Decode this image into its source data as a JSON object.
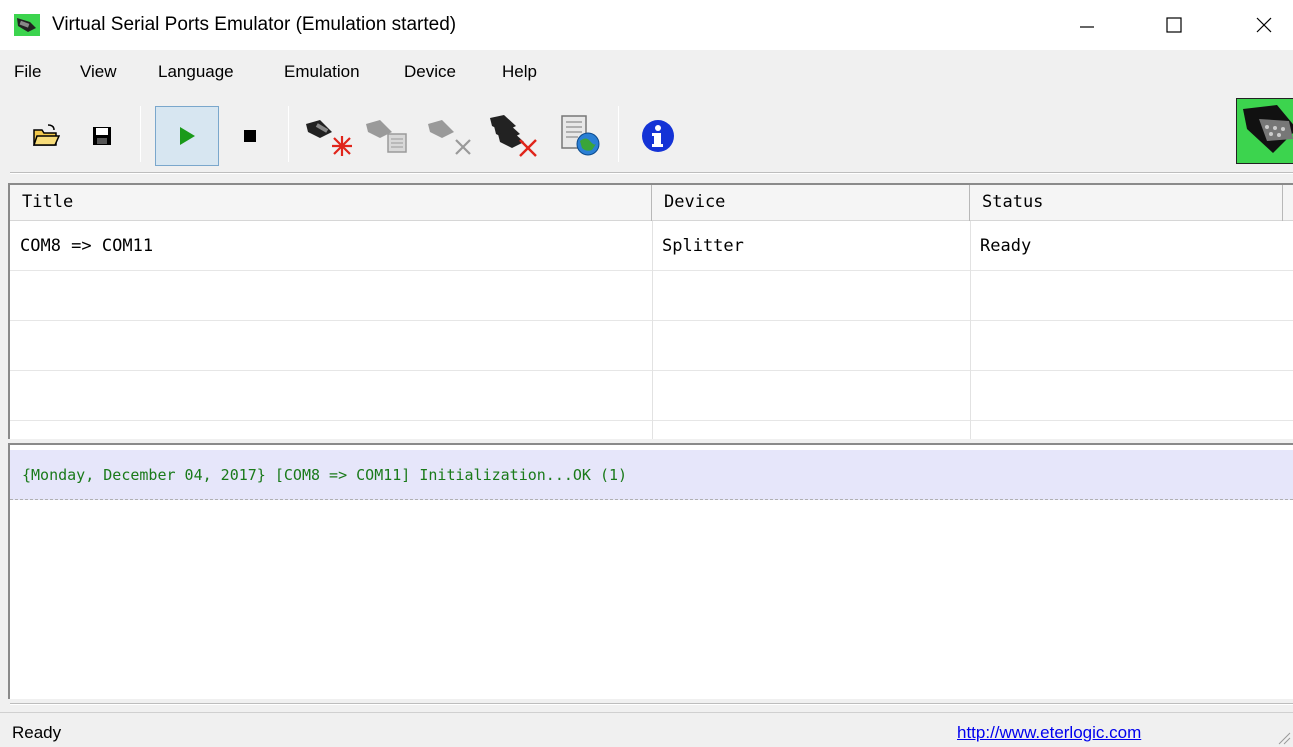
{
  "window": {
    "title": "Virtual Serial Ports Emulator (Emulation started)",
    "minimize": "—",
    "maximize": "☐",
    "close": "✕"
  },
  "menu": [
    "File",
    "View",
    "Language",
    "Emulation",
    "Device",
    "Help"
  ],
  "toolbar": {
    "buttons": [
      {
        "icon": "open-folder-icon",
        "active": false
      },
      {
        "icon": "save-icon",
        "active": false
      },
      {
        "icon": "play-icon",
        "active": true
      },
      {
        "icon": "stop-icon",
        "active": false
      },
      {
        "icon": "create-device-icon",
        "active": false
      },
      {
        "icon": "edit-device-icon",
        "disabled": true
      },
      {
        "icon": "delete-device-icon",
        "disabled": true
      },
      {
        "icon": "delete-all-devices-icon",
        "active": false
      },
      {
        "icon": "network-settings-icon",
        "active": false
      },
      {
        "icon": "info-icon",
        "active": false
      }
    ],
    "colors": {
      "play": "#1a9a1a",
      "accent_red": "#e0241a",
      "info": "#1433d6",
      "logo": "#3cd44e"
    }
  },
  "table": {
    "columns": [
      "Title",
      "Device",
      "Status"
    ],
    "rows": [
      [
        "COM8 => COM11",
        "Splitter",
        "Ready"
      ]
    ]
  },
  "log": {
    "lines": [
      "{Monday, December 04, 2017} [COM8 => COM11] Initialization...OK (1)"
    ],
    "color": "#1a7a1a"
  },
  "status": {
    "text": "Ready",
    "link": "http://www.eterlogic.com"
  }
}
